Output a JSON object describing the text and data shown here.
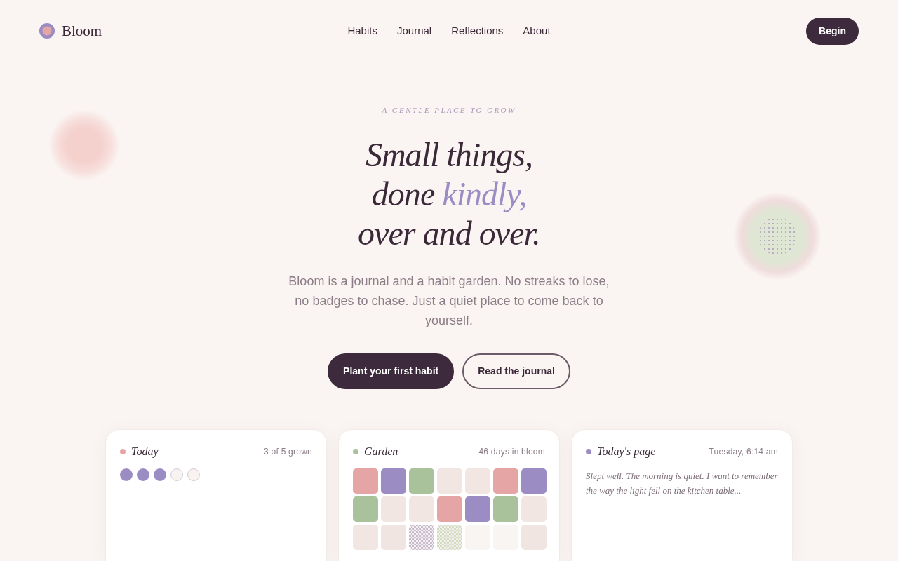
{
  "brand": {
    "name": "Bloom"
  },
  "nav": {
    "links": [
      "Habits",
      "Journal",
      "Reflections",
      "About"
    ],
    "cta": "Begin"
  },
  "hero": {
    "eyebrow": "A GENTLE PLACE TO GROW",
    "headline": [
      [
        {
          "text": "Small things,",
          "accent": false
        }
      ],
      [
        {
          "text": "done",
          "accent": false
        },
        {
          "text": "kindly,",
          "accent": true
        }
      ],
      [
        {
          "text": "over and over.",
          "accent": false
        }
      ]
    ],
    "intro": "Bloom is a journal and a habit garden. No streaks to lose, no badges to chase. Just a quiet place to come back to yourself.",
    "buttons": [
      {
        "label": "Plant your first habit",
        "kind": "primary"
      },
      {
        "label": "Read the journal",
        "kind": "secondary"
      }
    ]
  },
  "cards": [
    {
      "kind": "habits",
      "title": "Today",
      "color": "#e6a5a5",
      "meta": "3 of 5 grown",
      "habits": [
        {
          "done": true
        },
        {
          "done": true
        },
        {
          "done": true
        },
        {
          "done": false
        },
        {
          "done": false
        }
      ]
    },
    {
      "kind": "garden",
      "title": "Garden",
      "color": "#a9c29b",
      "meta": "46 days in bloom",
      "tiles": [
        {
          "kind": "solid",
          "color": "#e6a5a5"
        },
        {
          "kind": "solid",
          "color": "#9c8cc4"
        },
        {
          "kind": "solid",
          "color": "#a9c29b"
        },
        {
          "kind": "solid",
          "color": "#f2e6e2"
        },
        {
          "kind": "solid",
          "color": "#f2e6e2"
        },
        {
          "kind": "solid",
          "color": "#e6a5a5"
        },
        {
          "kind": "solid",
          "color": "#9c8cc4"
        },
        {
          "kind": "solid",
          "color": "#a9c29b"
        },
        {
          "kind": "solid",
          "color": "#f2e6e2"
        },
        {
          "kind": "solid",
          "color": "#f2e6e2"
        },
        {
          "kind": "solid",
          "color": "#e6a5a5"
        },
        {
          "kind": "solid",
          "color": "#9c8cc4"
        },
        {
          "kind": "solid",
          "color": "#a9c29b"
        },
        {
          "kind": "solid",
          "color": "#f2e6e2"
        },
        {
          "kind": "solid",
          "color": "#f2e6e2"
        },
        {
          "kind": "solid",
          "color": "#f1e5e1"
        },
        {
          "kind": "speckled",
          "color": "#c9bccf"
        },
        {
          "kind": "speckled",
          "color": "#d3dcbe"
        },
        {
          "kind": "solid",
          "color": "#f8f5f3"
        },
        {
          "kind": "solid",
          "color": "#f8f5f3"
        },
        {
          "kind": "solid",
          "color": "#f1e5e1"
        }
      ]
    },
    {
      "kind": "journal",
      "title": "Today's page",
      "color": "#9c8cc4",
      "meta": "Tuesday, 6:14 am",
      "entry": "Slept well. The morning is quiet. I want to remember the way the light fell on the kitchen table..."
    }
  ]
}
